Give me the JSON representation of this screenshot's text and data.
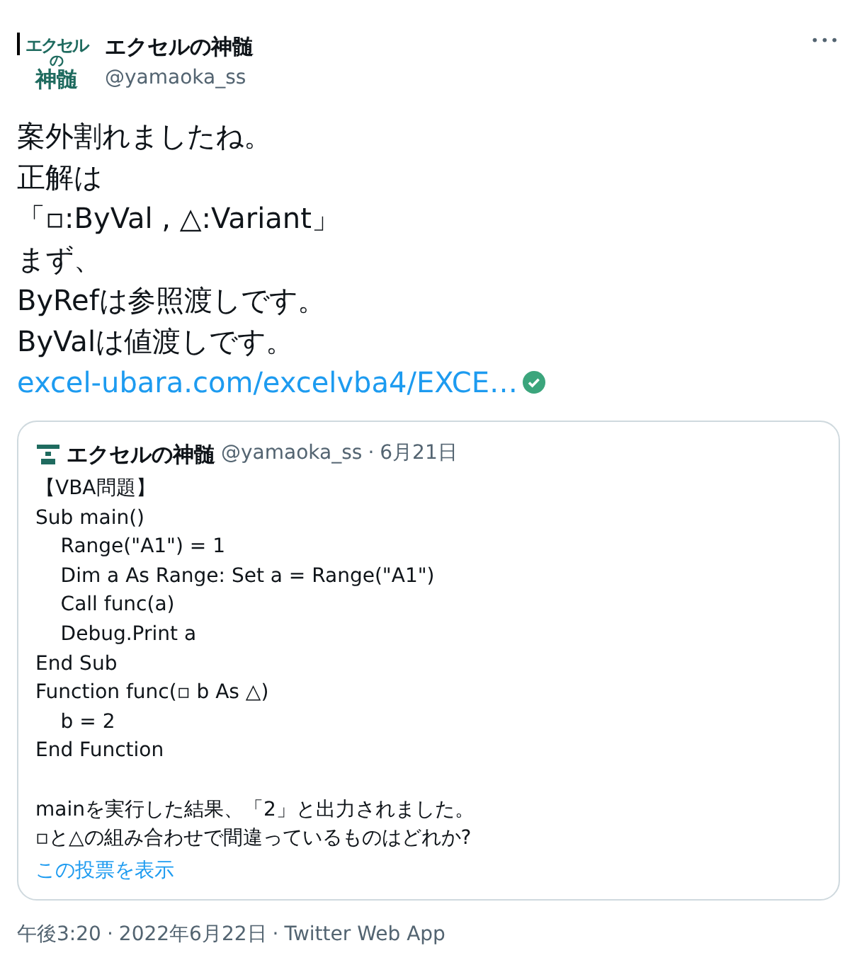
{
  "author": {
    "avatar_lines": [
      "エクセル",
      "の",
      "神髄"
    ],
    "name": "エクセルの神髄",
    "handle": "@yamaoka_ss"
  },
  "more_button": "•••",
  "body_lines": [
    "案外割れましたね。",
    "正解は",
    "「▫:ByVal , △:Variant」",
    "まず、",
    "ByRefは参照渡しです。",
    "ByValは値渡しです。"
  ],
  "link": {
    "text": "excel-ubara.com/excelvba4/EXCE…",
    "verified": true
  },
  "quote": {
    "name": "エクセルの神髄",
    "handle": "@yamaoka_ss",
    "separator": "·",
    "date": "6月21日",
    "code_lines": [
      "【VBA問題】",
      "Sub main()",
      "    Range(\"A1\") = 1",
      "    Dim a As Range: Set a = Range(\"A1\")",
      "    Call func(a)",
      "    Debug.Print a",
      "End Sub",
      "Function func(▫ b As △)",
      "    b = 2",
      "End Function"
    ],
    "question_lines": [
      "mainを実行した結果、「2」と出力されました。",
      "▫と△の組み合わせで間違っているものはどれか?"
    ],
    "poll_link": "この投票を表示"
  },
  "footer": {
    "time": "午後3:20",
    "separator_1": "·",
    "date": "2022年6月22日",
    "separator_2": "·",
    "source": "Twitter Web App"
  }
}
